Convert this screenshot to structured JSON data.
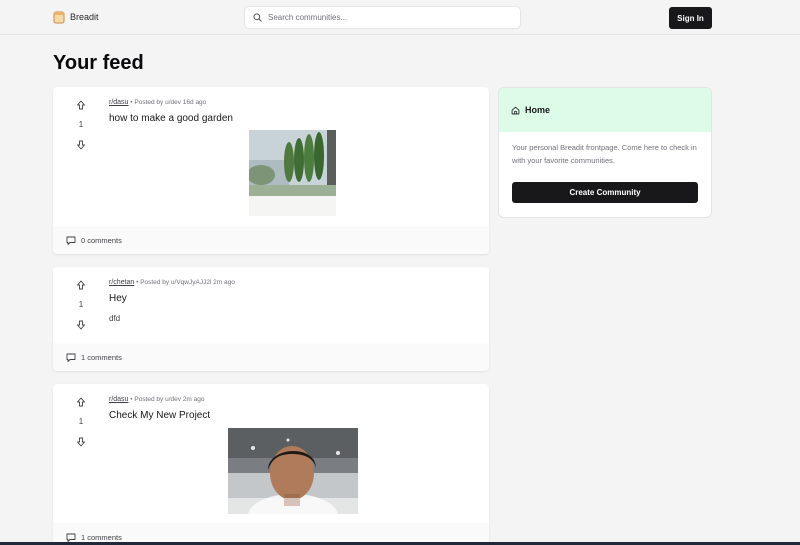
{
  "app": {
    "name": "Breadit"
  },
  "search": {
    "placeholder": "Search communities..."
  },
  "auth": {
    "sign_in_label": "Sign In"
  },
  "feed": {
    "title": "Your feed"
  },
  "posts": [
    {
      "subreddit": "r/dasu",
      "byline": "Posted by u/dev 16d ago",
      "title": "how to make a good garden",
      "votes": "1",
      "comments": "0 comments",
      "media": "garden photo"
    },
    {
      "subreddit": "r/chetan",
      "byline": "Posted by u/VqwJyAJJ2l 2m ago",
      "title": "Hey",
      "body": "dfd",
      "votes": "1",
      "comments": "1 comments"
    },
    {
      "subreddit": "r/dasu",
      "byline": "Posted by u/dev 2m ago",
      "title": "Check My New Project",
      "votes": "1",
      "comments": "1 comments",
      "media": "portrait photo"
    }
  ],
  "sidebar": {
    "title": "Home",
    "description": "Your personal Breadit frontpage. Come here to check in with your favorite communities.",
    "create_label": "Create Community"
  },
  "colors": {
    "accent_green": "#dcfce7",
    "button_dark": "#18181b",
    "page_bg": "#f4f4f5"
  },
  "icons": [
    "bread-logo-icon",
    "search-icon",
    "home-icon",
    "arrow-up-icon",
    "arrow-down-icon",
    "comment-icon"
  ]
}
